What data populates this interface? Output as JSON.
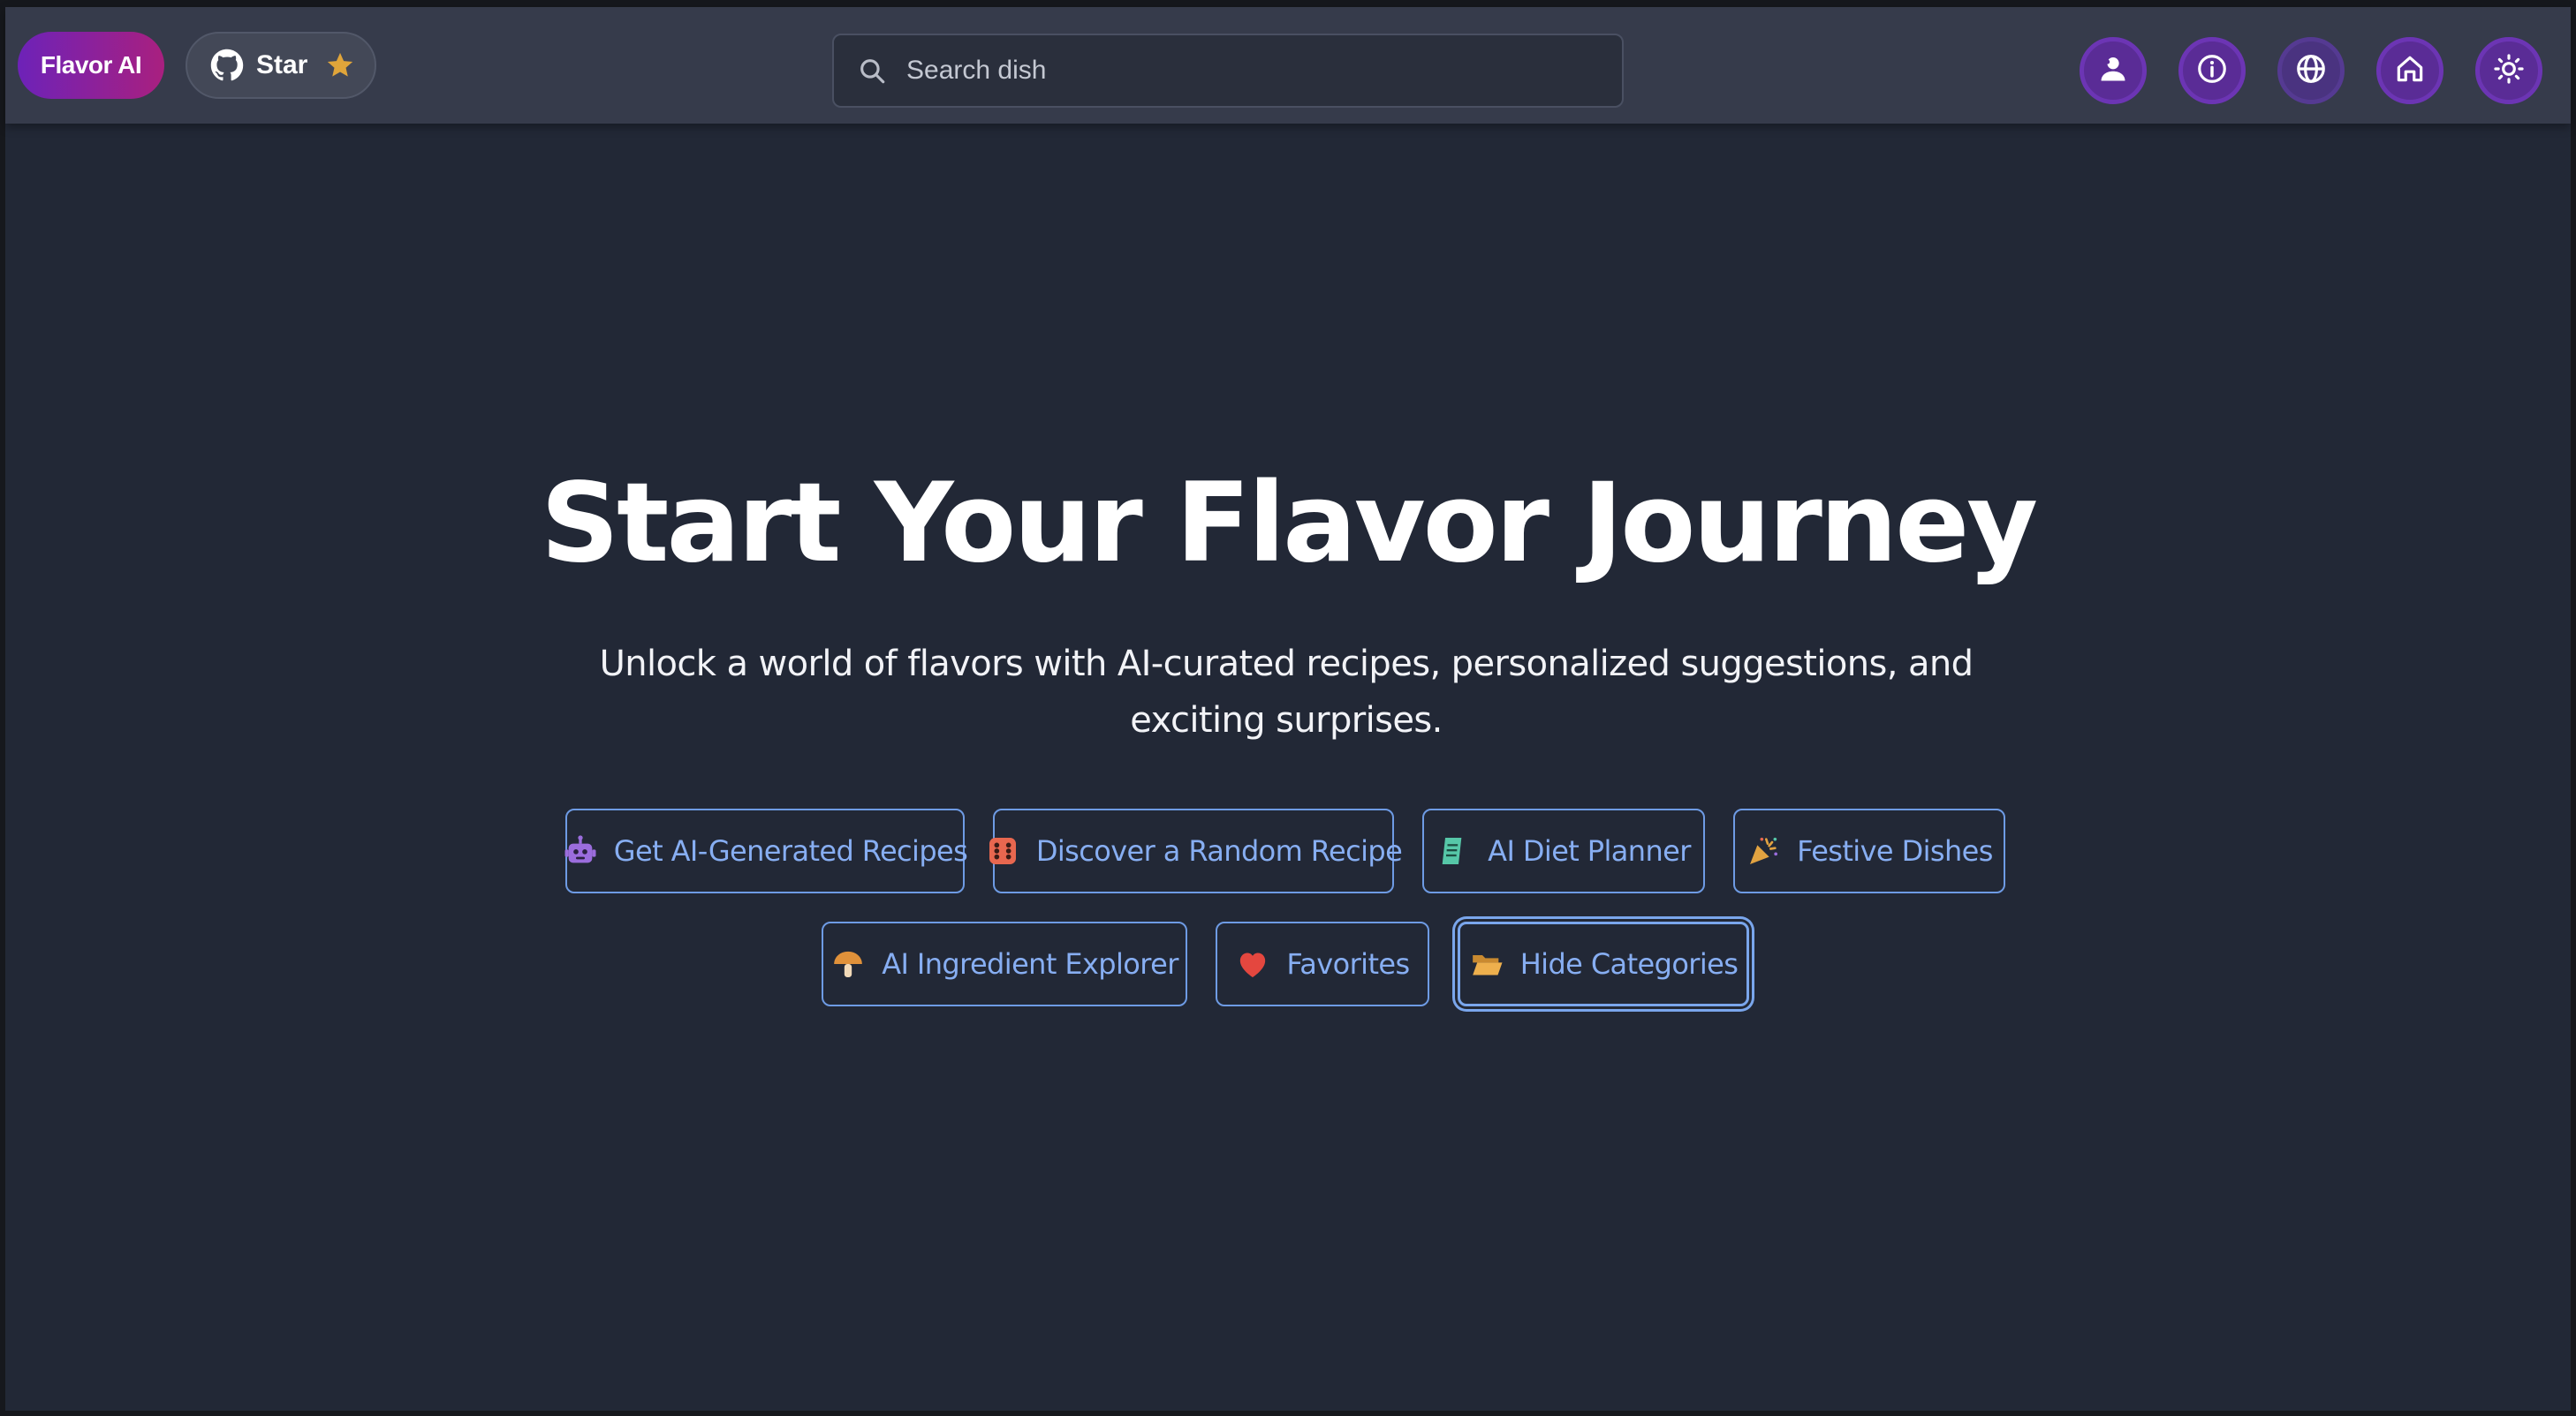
{
  "header": {
    "brand_label": "Flavor AI",
    "star_label": "Star",
    "search": {
      "placeholder": "Search dish"
    },
    "icon_buttons": [
      {
        "name": "profile-icon"
      },
      {
        "name": "info-icon"
      },
      {
        "name": "globe-icon"
      },
      {
        "name": "home-icon"
      },
      {
        "name": "sun-icon"
      }
    ]
  },
  "hero": {
    "title": "Start Your Flavor Journey",
    "subtitle": "Unlock a world of flavors with AI-curated recipes, personalized suggestions, and exciting surprises."
  },
  "actions": {
    "row1": [
      {
        "label": "Get AI-Generated Recipes",
        "icon": "robot-icon"
      },
      {
        "label": "Discover a Random Recipe",
        "icon": "dice-icon"
      },
      {
        "label": "AI Diet Planner",
        "icon": "notepad-icon"
      },
      {
        "label": "Festive Dishes",
        "icon": "party-popper-icon"
      }
    ],
    "row2": [
      {
        "label": "AI Ingredient Explorer",
        "icon": "mushroom-icon"
      },
      {
        "label": "Favorites",
        "icon": "heart-icon"
      },
      {
        "label": "Hide Categories",
        "icon": "open-folder-icon"
      }
    ]
  },
  "colors": {
    "background": "#222836",
    "header": "#363b4b",
    "brand_gradient_start": "#6d22b8",
    "brand_gradient_end": "#a9207f",
    "button_border": "#6e9be4",
    "button_text": "#87aef2",
    "round_button": "#5a2c96"
  }
}
